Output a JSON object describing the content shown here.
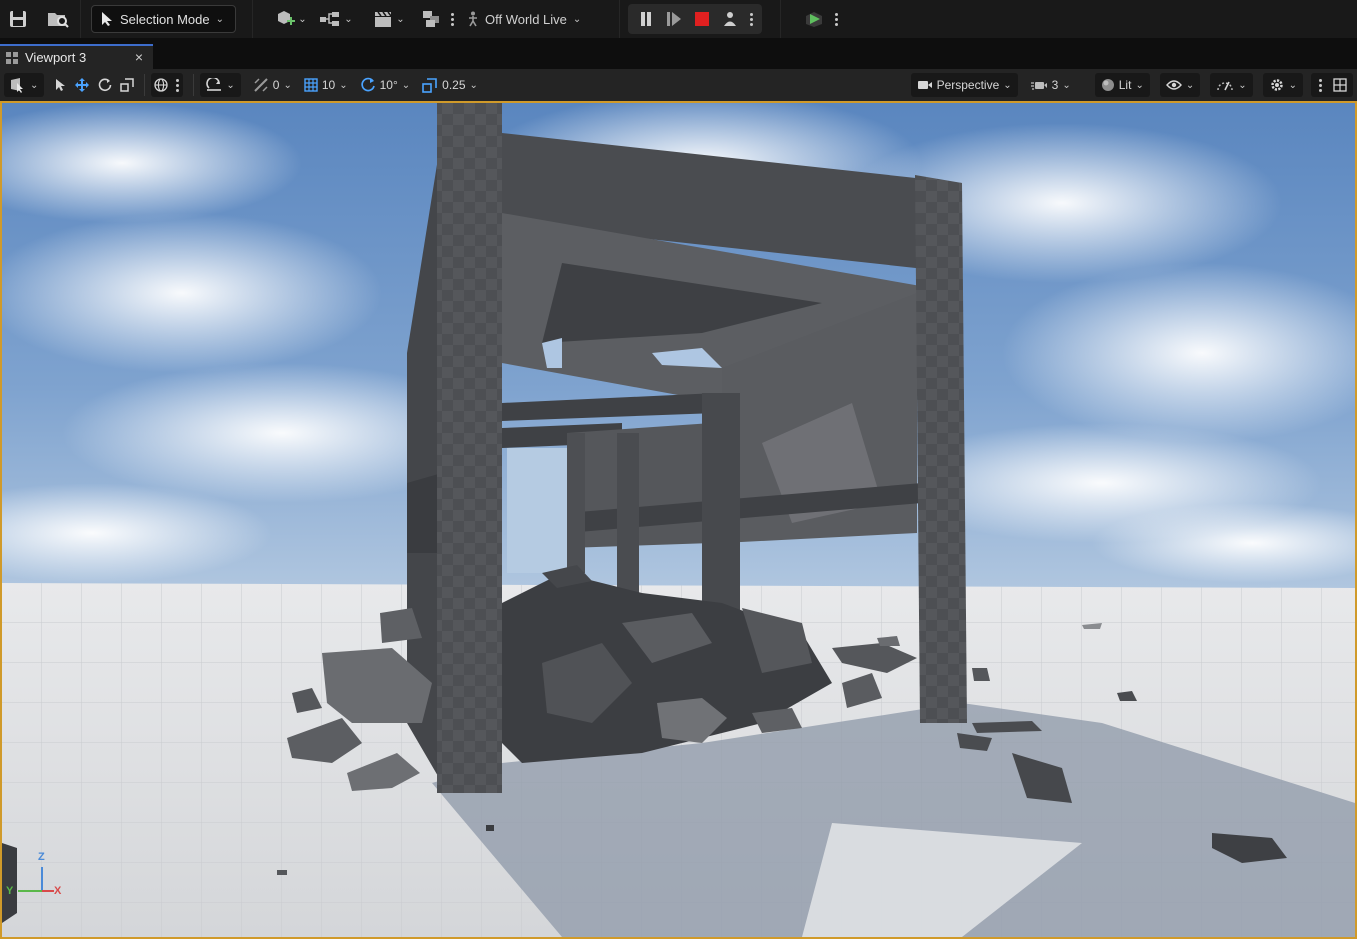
{
  "toolbar": {
    "mode_label": "Selection Mode",
    "world_label": "Off World Live"
  },
  "tab": {
    "title": "Viewport 3",
    "close_glyph": "×"
  },
  "viewport_toolbar": {
    "rotation_snap_value": "0",
    "grid_snap_value": "10",
    "angle_snap_value": "10°",
    "scale_snap_value": "0.25",
    "view_mode": "Perspective",
    "camera_speed": "3",
    "lighting_mode": "Lit"
  },
  "axis_gizmo": {
    "z": "Z",
    "y": "Y",
    "x": "X"
  },
  "colors": {
    "accent_blue": "#3d6dcc",
    "viewport_border": "#d09a2a",
    "stop_red": "#e02020",
    "play_green": "#5fbf5f"
  }
}
